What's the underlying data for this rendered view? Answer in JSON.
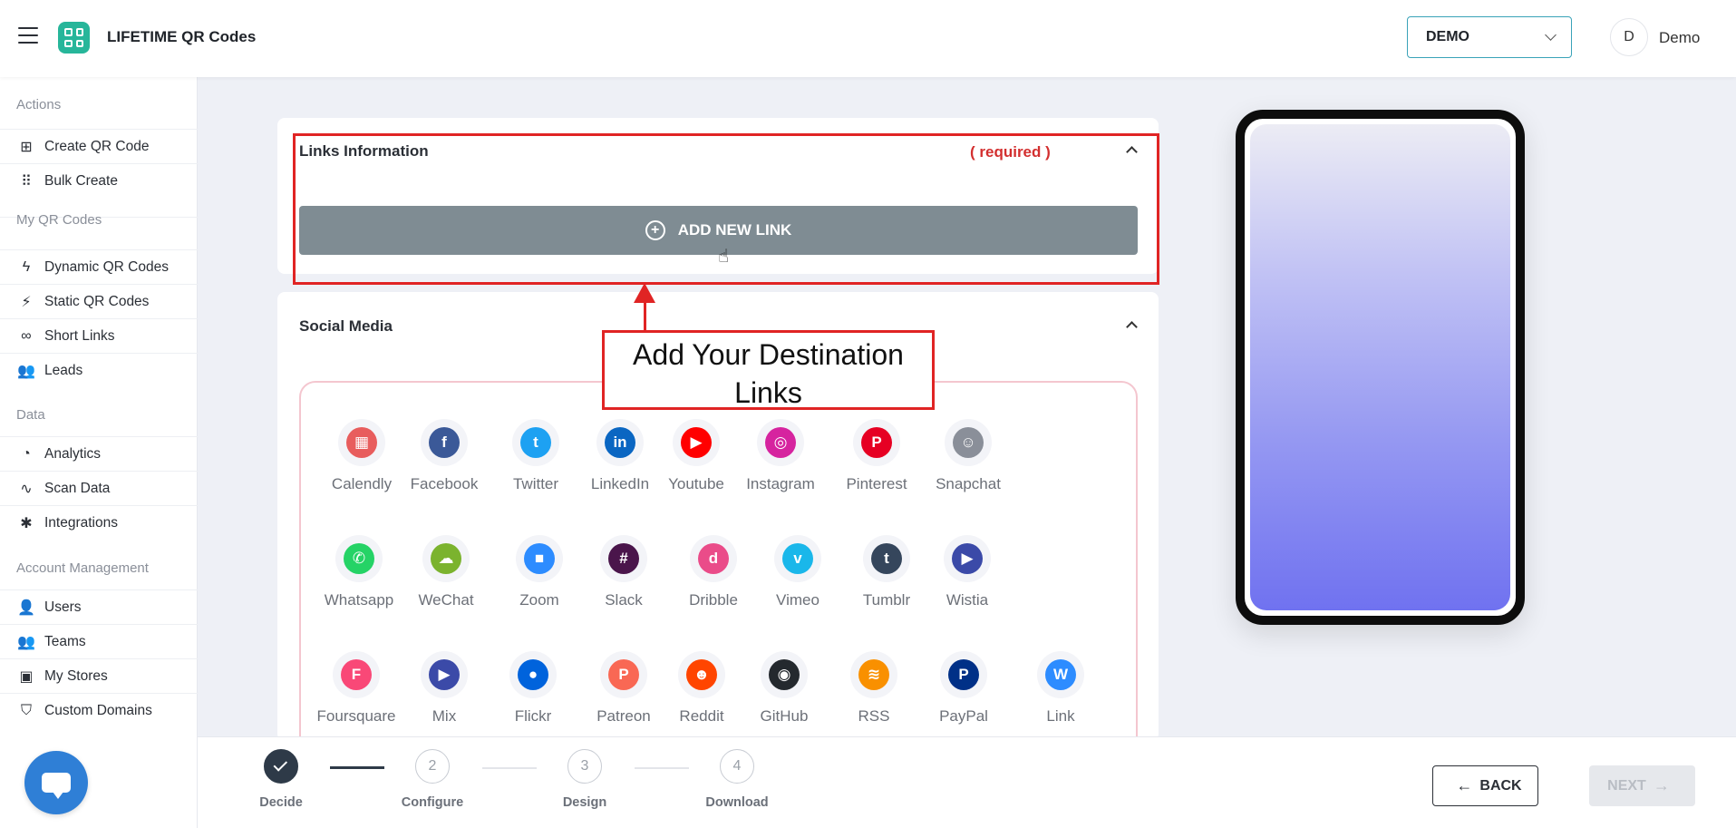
{
  "header": {
    "app_title": "LIFETIME QR Codes",
    "workspace": "DEMO",
    "avatar_initial": "D",
    "user_name": "Demo"
  },
  "sidebar": {
    "sections": [
      {
        "title": "Actions",
        "items": [
          {
            "label": "Create QR Code",
            "icon": "plus-square-icon"
          },
          {
            "label": "Bulk Create",
            "icon": "grid-icon"
          }
        ]
      },
      {
        "title": "My QR Codes",
        "items": [
          {
            "label": "Dynamic QR Codes",
            "icon": "bolt-icon"
          },
          {
            "label": "Static QR Codes",
            "icon": "bolt-off-icon"
          },
          {
            "label": "Short Links",
            "icon": "link-icon"
          },
          {
            "label": "Leads",
            "icon": "users-icon"
          }
        ]
      },
      {
        "title": "Data",
        "items": [
          {
            "label": "Analytics",
            "icon": "pie-chart-icon"
          },
          {
            "label": "Scan Data",
            "icon": "activity-icon"
          },
          {
            "label": "Integrations",
            "icon": "plug-icon"
          }
        ]
      },
      {
        "title": "Account Management",
        "items": [
          {
            "label": "Users",
            "icon": "user-plus-icon"
          },
          {
            "label": "Teams",
            "icon": "users-icon"
          },
          {
            "label": "My Stores",
            "icon": "store-icon"
          },
          {
            "label": "Custom Domains",
            "icon": "shield-icon"
          }
        ]
      }
    ]
  },
  "links_card": {
    "title": "Links Information",
    "required": "( required )",
    "add_button": "ADD NEW LINK"
  },
  "annotation": {
    "callout": "Add Your Destination Links"
  },
  "social_card": {
    "title": "Social Media",
    "items": [
      {
        "label": "Calendly",
        "color": "#e85d5d"
      },
      {
        "label": "Facebook",
        "color": "#3b5998"
      },
      {
        "label": "Twitter",
        "color": "#1da1f2"
      },
      {
        "label": "LinkedIn",
        "color": "#0a66c2"
      },
      {
        "label": "Youtube",
        "color": "#ff0000"
      },
      {
        "label": "Instagram",
        "color": "#d6249f"
      },
      {
        "label": "Pinterest",
        "color": "#e60023"
      },
      {
        "label": "Snapchat",
        "color": "#8a8f99"
      },
      {
        "label": "Whatsapp",
        "color": "#25d366"
      },
      {
        "label": "WeChat",
        "color": "#7bb32e"
      },
      {
        "label": "Zoom",
        "color": "#2d8cff"
      },
      {
        "label": "Slack",
        "color": "#4a154b"
      },
      {
        "label": "Dribble",
        "color": "#ea4c89"
      },
      {
        "label": "Vimeo",
        "color": "#1ab7ea"
      },
      {
        "label": "Tumblr",
        "color": "#35465c"
      },
      {
        "label": "Wistia",
        "color": "#3b4aa8"
      },
      {
        "label": "Foursquare",
        "color": "#f94877"
      },
      {
        "label": "Mix",
        "color": "#3b4aa8"
      },
      {
        "label": "Flickr",
        "color": "#0063dc"
      },
      {
        "label": "Patreon",
        "color": "#f96854"
      },
      {
        "label": "Reddit",
        "color": "#ff4500"
      },
      {
        "label": "GitHub",
        "color": "#24292e"
      },
      {
        "label": "RSS",
        "color": "#f99000"
      },
      {
        "label": "PayPal",
        "color": "#003087"
      },
      {
        "label": "Link",
        "color": "#2d8cff"
      }
    ]
  },
  "stepper": {
    "steps": [
      {
        "num": "",
        "label": "Decide"
      },
      {
        "num": "2",
        "label": "Configure"
      },
      {
        "num": "3",
        "label": "Design"
      },
      {
        "num": "4",
        "label": "Download"
      }
    ]
  },
  "footer": {
    "back": "BACK",
    "next": "NEXT"
  }
}
